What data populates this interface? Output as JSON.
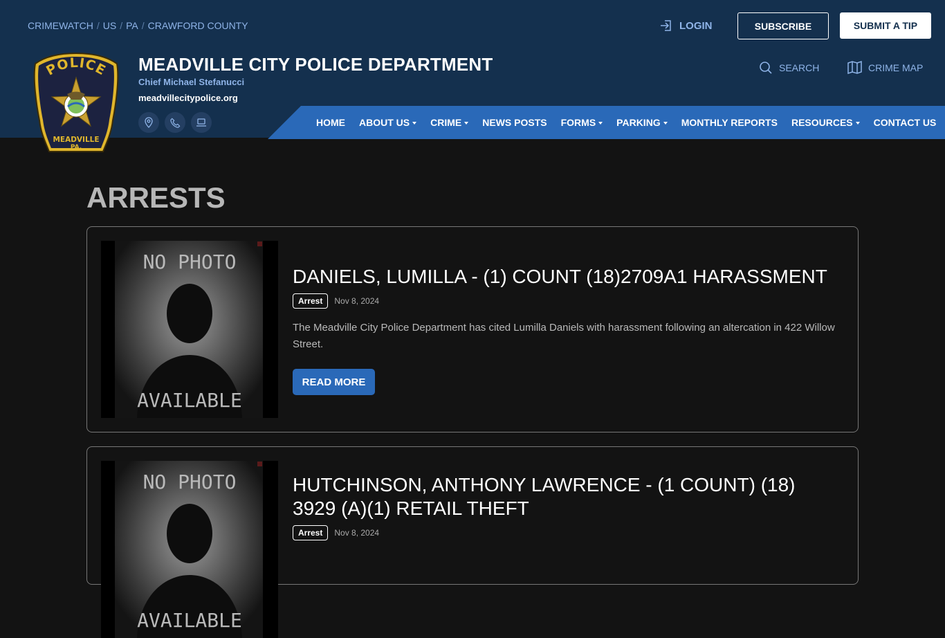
{
  "breadcrumb": [
    "CRIMEWATCH",
    "US",
    "PA",
    "CRAWFORD COUNTY"
  ],
  "header": {
    "login": "LOGIN",
    "subscribe": "SUBSCRIBE",
    "submit_tip": "SUBMIT A TIP",
    "title": "MEADVILLE CITY POLICE DEPARTMENT",
    "chief": "Chief Michael Stefanucci",
    "website": "meadvillecitypolice.org",
    "search": "SEARCH",
    "crime_map": "CRIME MAP",
    "badge_text": {
      "top": "POLICE",
      "bottom1": "MEADVILLE",
      "bottom2": "PA."
    }
  },
  "nav": [
    {
      "label": "HOME",
      "dropdown": false
    },
    {
      "label": "ABOUT US",
      "dropdown": true
    },
    {
      "label": "CRIME",
      "dropdown": true
    },
    {
      "label": "NEWS POSTS",
      "dropdown": false
    },
    {
      "label": "FORMS",
      "dropdown": true
    },
    {
      "label": "PARKING",
      "dropdown": true
    },
    {
      "label": "MONTHLY REPORTS",
      "dropdown": false
    },
    {
      "label": "RESOURCES",
      "dropdown": true
    },
    {
      "label": "CONTACT US",
      "dropdown": false
    }
  ],
  "page": {
    "title": "ARRESTS"
  },
  "posts": [
    {
      "title": "DANIELS, LUMILLA - (1) COUNT (18)2709A1 HARASSMENT",
      "tag": "Arrest",
      "date": "Nov 8, 2024",
      "summary": "The Meadville City Police Department has cited Lumilla Daniels with harassment following an altercation in 422 Willow Street.",
      "read_more": "READ MORE",
      "photo_top": "NO PHOTO",
      "photo_bottom": "AVAILABLE"
    },
    {
      "title": "HUTCHINSON, ANTHONY LAWRENCE - (1 COUNT) (18) 3929 (A)(1) RETAIL THEFT",
      "tag": "Arrest",
      "date": "Nov 8, 2024",
      "photo_top": "NO PHOTO",
      "photo_bottom": "AVAILABLE"
    }
  ],
  "colors": {
    "header_bg": "#14304e",
    "nav_bg": "#2a69b8",
    "link": "#8fb4e8",
    "page_bg": "#131313"
  }
}
